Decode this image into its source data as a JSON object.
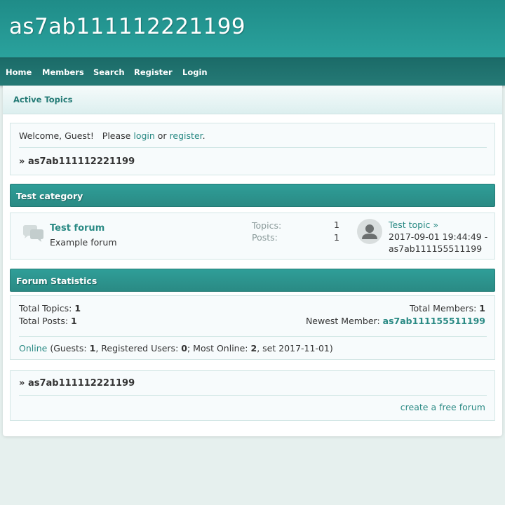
{
  "site": {
    "title": "as7ab111112221199"
  },
  "nav": {
    "items": [
      {
        "label": "Home"
      },
      {
        "label": "Members"
      },
      {
        "label": "Search"
      },
      {
        "label": "Register"
      },
      {
        "label": "Login"
      }
    ]
  },
  "subnav": {
    "active_topics": "Active Topics"
  },
  "welcome": {
    "prefix": "Welcome, Guest!",
    "please": "Please",
    "login": "login",
    "or": "or",
    "register": "register",
    "period": ".",
    "breadcrumb_arrow": "»",
    "breadcrumb": "as7ab111112221199"
  },
  "category": {
    "name": "Test category",
    "forums": [
      {
        "title": "Test forum",
        "description": "Example forum",
        "topics_label": "Topics:",
        "topics": "1",
        "posts_label": "Posts:",
        "posts": "1",
        "last_post_title": "Test topic",
        "last_post_arrow": "»",
        "last_post_date": "2017-09-01 19:44:49 -",
        "last_post_user": "as7ab111155511199"
      }
    ]
  },
  "statistics": {
    "header": "Forum Statistics",
    "total_topics_label": "Total Topics:",
    "total_topics": "1",
    "total_posts_label": "Total Posts:",
    "total_posts": "1",
    "total_members_label": "Total Members:",
    "total_members": "1",
    "newest_member_label": "Newest Member:",
    "newest_member": "as7ab111155511199",
    "online_link": "Online",
    "guests_label": "(Guests:",
    "guests": "1",
    "registered_label": ", Registered Users:",
    "registered": "0",
    "most_online_label": "; Most Online:",
    "most_online": "2",
    "set_label": ", set 2017-11-01)"
  },
  "footer": {
    "breadcrumb_arrow": "»",
    "breadcrumb": "as7ab111112221199",
    "free_forum_link": "create a free forum"
  },
  "colors": {
    "header_bg": "#2aa29d",
    "nav_bg": "#1f706c",
    "link": "#2a8a84",
    "category_header": "#2a8a84"
  },
  "icons": {
    "forum": "speech-bubbles-icon",
    "avatar": "default-user-avatar-icon"
  }
}
